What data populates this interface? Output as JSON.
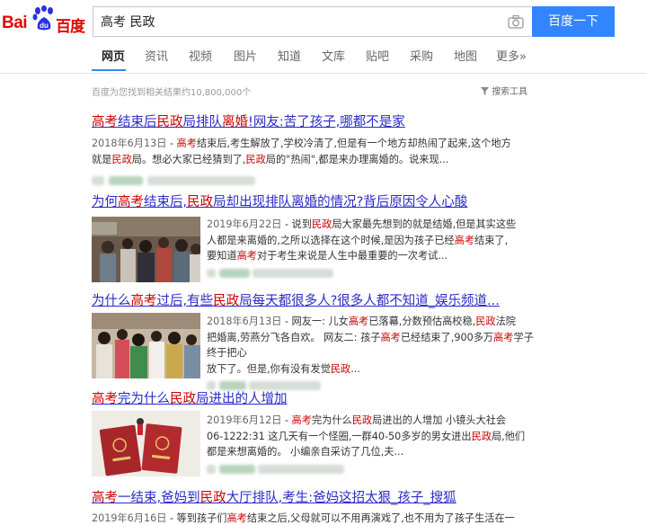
{
  "brand": {
    "logo_text_left": "Bai",
    "logo_text_paw": "du",
    "logo_text_right": "百度"
  },
  "search": {
    "query": "高考 民政",
    "button_label": "百度一下",
    "camera_icon": "camera-icon"
  },
  "nav": {
    "tabs": [
      "网页",
      "资讯",
      "视频",
      "图片",
      "知道",
      "文库",
      "贴吧",
      "采购",
      "地图",
      "更多»"
    ],
    "active": "网页"
  },
  "results_count": "百度为您找到相关结果约10,800,000个",
  "search_tools": "搜索工具",
  "results": [
    {
      "title_parts": [
        [
          "高考",
          true
        ],
        [
          "结束后",
          false
        ],
        [
          "民政",
          true
        ],
        [
          "局排队",
          false
        ],
        [
          "离婚",
          true
        ],
        [
          "!网友:苦了孩子,哪都不是家",
          false
        ]
      ],
      "date": "2018年6月13日",
      "desc_lines": [
        [
          [
            " - ",
            false
          ],
          [
            "高考",
            true
          ],
          [
            "结束后,考生解放了,学校冷清了,但是有一个地方却热闹了起来,这个地方",
            false
          ]
        ],
        [
          [
            "就是",
            false
          ],
          [
            "民政",
            true
          ],
          [
            "局。想必大家已经猜到了,",
            false
          ],
          [
            "民政",
            true
          ],
          [
            "局的\"热闹\",都是来办理离婚的。说来现...",
            false
          ]
        ]
      ]
    },
    {
      "title_parts": [
        [
          "为何",
          false
        ],
        [
          "高考",
          true
        ],
        [
          "结束后,",
          false
        ],
        [
          "民政",
          true
        ],
        [
          "局却出现排队离婚的情况?背后原因令人心酸",
          false
        ]
      ],
      "date": "2019年6月22日",
      "desc_lines": [
        [
          [
            " - 说到",
            false
          ],
          [
            "民政",
            true
          ],
          [
            "局大家最先想到的就是结婚,但是其实这些",
            false
          ]
        ],
        [
          [
            "人都是来离婚的,之所以选择在这个时候,是因为孩子已经",
            false
          ],
          [
            "高考",
            true
          ],
          [
            "结束了,",
            false
          ]
        ],
        [
          [
            "要知道",
            false
          ],
          [
            "高考",
            true
          ],
          [
            "对于考生来说是人生中最重要的一次考试...",
            false
          ]
        ]
      ]
    },
    {
      "title_parts": [
        [
          "为什么",
          false
        ],
        [
          "高考",
          true
        ],
        [
          "过后,有些",
          false
        ],
        [
          "民政",
          true
        ],
        [
          "局每天都很多人?很多人都不知道_娱乐频道...",
          false
        ]
      ],
      "date": "2018年6月13日",
      "desc_lines": [
        [
          [
            " - 网友一: 儿女",
            false
          ],
          [
            "高考",
            true
          ],
          [
            "已落幕,分数预估高校稳,",
            false
          ],
          [
            "民政",
            true
          ],
          [
            "法院",
            false
          ]
        ],
        [
          [
            "把婚离,劳燕分飞各自欢。 网友二: 孩子",
            false
          ],
          [
            "高考",
            true
          ],
          [
            "已经结束了,900多万",
            false
          ],
          [
            "高考",
            true
          ],
          [
            "学子终于把心",
            false
          ]
        ],
        [
          [
            "放下了。但是,你有没有发觉",
            false
          ],
          [
            "民政",
            true
          ],
          [
            "...",
            false
          ]
        ]
      ]
    },
    {
      "title_parts": [
        [
          "高考",
          true
        ],
        [
          "完为什么",
          false
        ],
        [
          "民政",
          true
        ],
        [
          "局进出的人增加",
          false
        ]
      ],
      "date": "2019年6月12日",
      "desc_lines": [
        [
          [
            " - ",
            false
          ],
          [
            "高考",
            true
          ],
          [
            "完为什么",
            false
          ],
          [
            "民政",
            true
          ],
          [
            "局进出的人增加 小镜头大社会",
            false
          ]
        ],
        [
          [
            "06-1222:31 这几天有一个怪圈,一群40-50多岁的男女进出",
            false
          ],
          [
            "民政",
            true
          ],
          [
            "局,他们",
            false
          ]
        ],
        [
          [
            "都是来想离婚的。 小编亲自采访了几位,夫...",
            false
          ]
        ]
      ]
    },
    {
      "title_parts": [
        [
          "高考",
          true
        ],
        [
          "一结束,爸妈到",
          false
        ],
        [
          "民政",
          true
        ],
        [
          "大厅排队,考生:爸妈这招太狠_孩子_搜狐",
          false
        ]
      ],
      "date": "2019年6月16日",
      "desc_lines": [
        [
          [
            " - 等到孩子们",
            false
          ],
          [
            "高考",
            true
          ],
          [
            "结束之后,父母就可以不用再演戏了,也不用为了孩子生活在一",
            false
          ]
        ]
      ]
    }
  ],
  "colors": {
    "link": "#2b2bc8",
    "highlight": "#cc0000",
    "button": "#3385ff",
    "logo": "#e10602"
  }
}
